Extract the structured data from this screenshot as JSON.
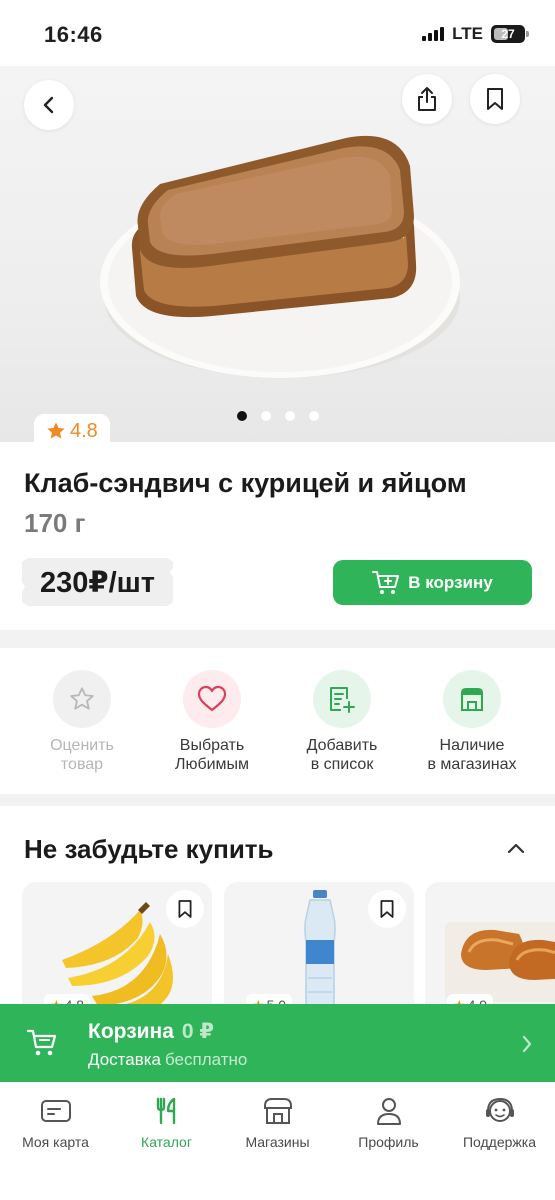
{
  "status": {
    "time": "16:46",
    "network": "LTE",
    "battery": "27"
  },
  "product": {
    "rating": "4.8",
    "title": "Клаб-сэндвич с курицей и яйцом",
    "weight": "170 г",
    "price": "230₽/шт",
    "add_to_cart": "В корзину",
    "gallery_count": 4,
    "gallery_active": 1
  },
  "actions": [
    {
      "label_line1": "Оценить",
      "label_line2": "товар",
      "icon": "star-outline-icon",
      "enabled": false
    },
    {
      "label_line1": "Выбрать",
      "label_line2": "Любимым",
      "icon": "heart-icon",
      "enabled": true
    },
    {
      "label_line1": "Добавить",
      "label_line2": "в список",
      "icon": "list-add-icon",
      "enabled": true
    },
    {
      "label_line1": "Наличие",
      "label_line2": "в магазинах",
      "icon": "store-icon",
      "enabled": true
    }
  ],
  "reminder": {
    "title": "Не забудьте купить",
    "items": [
      {
        "rating": "4.8",
        "image": "bananas"
      },
      {
        "rating": "5.0",
        "image": "water-bottle"
      },
      {
        "rating": "4.9",
        "image": "pastries"
      }
    ]
  },
  "basket": {
    "label": "Корзина",
    "sum": "0 ₽",
    "delivery_label": "Доставка",
    "delivery_value": "бесплатно"
  },
  "tabs": [
    {
      "label": "Моя карта",
      "icon": "card-icon"
    },
    {
      "label": "Каталог",
      "icon": "fork-knife-icon",
      "active": true
    },
    {
      "label": "Магазины",
      "icon": "store-icon"
    },
    {
      "label": "Профиль",
      "icon": "person-icon"
    },
    {
      "label": "Поддержка",
      "icon": "support-icon"
    }
  ],
  "colors": {
    "brand_green": "#2fb45a",
    "rating_orange": "#f08a24",
    "heart_red": "#d9415b"
  }
}
